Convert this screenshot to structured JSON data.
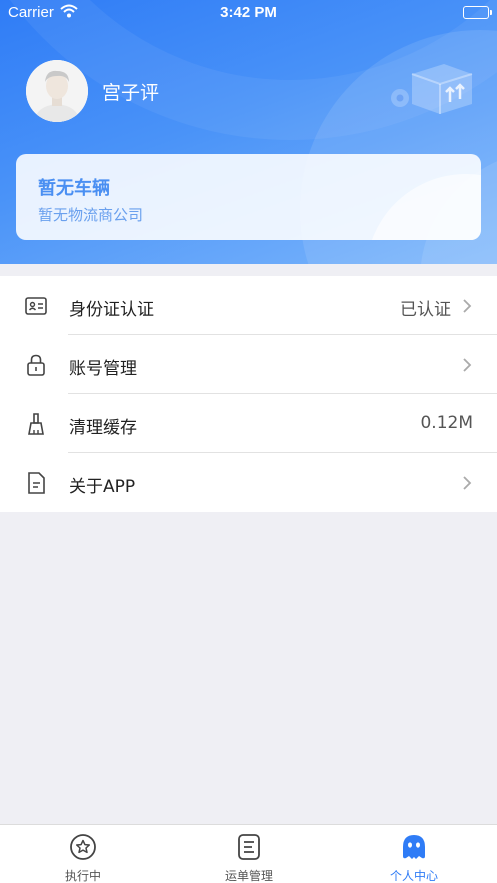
{
  "status_bar": {
    "carrier": "Carrier",
    "time": "3:42 PM"
  },
  "profile": {
    "name": "宫子评"
  },
  "vehicle_card": {
    "title": "暂无车辆",
    "company": "暂无物流商公司"
  },
  "menu": {
    "items": [
      {
        "label": "身份证认证",
        "value": "已认证",
        "icon": "id-card-icon",
        "arrow": true
      },
      {
        "label": "账号管理",
        "value": "",
        "icon": "lock-icon",
        "arrow": true
      },
      {
        "label": "清理缓存",
        "value": "0.12M",
        "icon": "broom-icon",
        "arrow": false
      },
      {
        "label": "关于APP",
        "value": "",
        "icon": "document-icon",
        "arrow": true
      }
    ]
  },
  "tabbar": {
    "tabs": [
      {
        "label": "执行中",
        "icon": "star-circle-icon",
        "active": false
      },
      {
        "label": "运单管理",
        "icon": "waybill-icon",
        "active": false
      },
      {
        "label": "个人中心",
        "icon": "person-blob-icon",
        "active": true
      }
    ],
    "active_color": "#2f7cf6"
  },
  "colors": {
    "header_blue": "#2f7cf6",
    "page_bg": "#efeff4"
  }
}
